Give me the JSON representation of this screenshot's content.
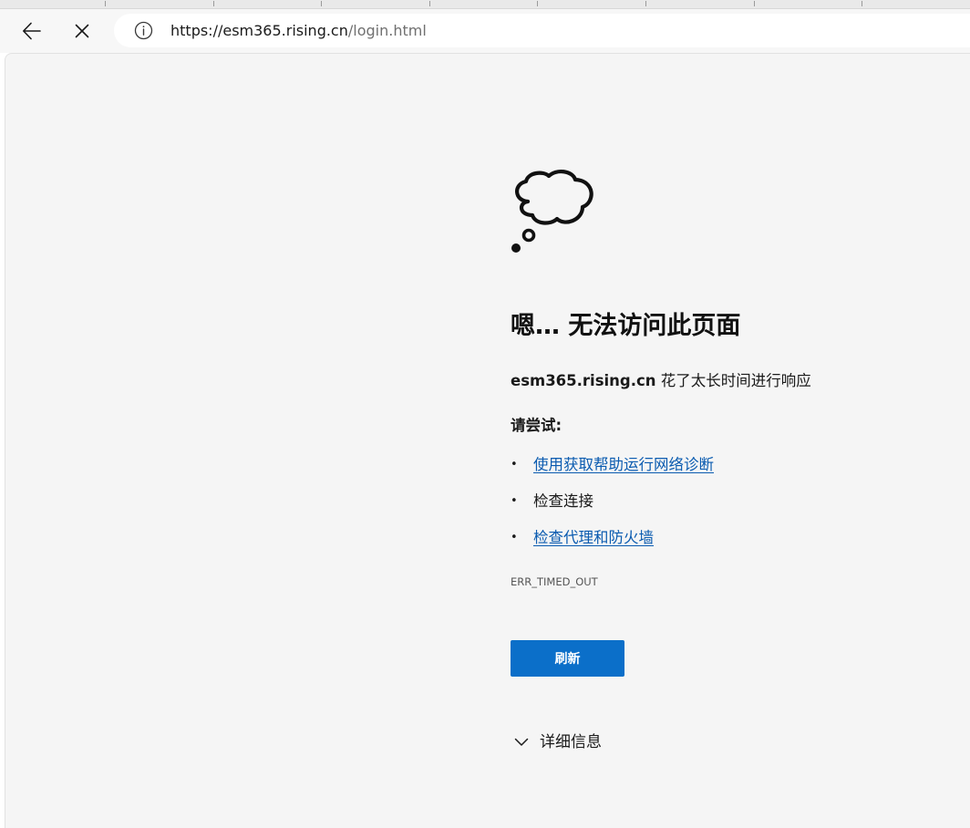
{
  "browser": {
    "url_host": "https://esm365.rising.cn",
    "url_path": "/login.html",
    "back_icon": "back-arrow-icon",
    "stop_icon": "close-icon",
    "site_info_icon": "info-icon"
  },
  "error_page": {
    "illustration_icon": "thought-cloud-icon",
    "heading": "嗯… 无法访问此页面",
    "host": "esm365.rising.cn",
    "message": " 花了太长时间进行响应",
    "try_label": "请尝试:",
    "suggestions": [
      {
        "text": "使用获取帮助运行网络诊断",
        "is_link": true
      },
      {
        "text": "检查连接",
        "is_link": false
      },
      {
        "text": "检查代理和防火墙",
        "is_link": true
      }
    ],
    "error_code": "ERR_TIMED_OUT",
    "refresh_label": "刷新",
    "details_label": "详细信息",
    "details_icon": "chevron-down-icon"
  },
  "colors": {
    "link": "#0a5bb0",
    "primary_button": "#0b6fc9",
    "page_background": "#f5f5f5"
  }
}
